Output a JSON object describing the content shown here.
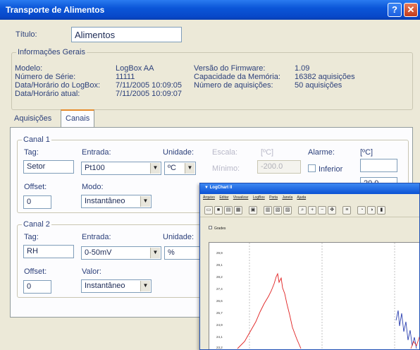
{
  "window": {
    "title": "Transporte de Alimentos",
    "help_glyph": "?",
    "close_glyph": "✕"
  },
  "titulo": {
    "label": "Título:",
    "value": "Alimentos"
  },
  "info": {
    "title": "Informações Gerais",
    "left_labels": [
      "Modelo:",
      "Número de Série:",
      "Data/Horário do LogBox:",
      "Data/Horário atual:"
    ],
    "left_values": [
      "LogBox AA",
      "11111",
      "7/11/2005 10:09:05",
      "7/11/2005 10:09:07"
    ],
    "right_labels": [
      "Versão do Firmware:",
      "Capacidade da Memória:",
      "Número de aquisições:"
    ],
    "right_values": [
      "1.09",
      "16382 aquisições",
      "50 aquisições"
    ]
  },
  "tabs": [
    {
      "label": "Aquisições"
    },
    {
      "label": "Canais"
    }
  ],
  "canal1": {
    "title": "Canal 1",
    "tag_label": "Tag:",
    "tag_value": "Setor",
    "entrada_label": "Entrada:",
    "entrada_value": "Pt100",
    "unidade_label": "Unidade:",
    "unidade_value": "ºC",
    "offset_label": "Offset:",
    "offset_value": "0",
    "modo_label": "Modo:",
    "modo_value": "Instantâneo",
    "escala_label": "Escala:",
    "escala_unit": "[ºC]",
    "minimo_label": "Mínimo:",
    "minimo_value": "-200.0",
    "alarme_label": "Alarme:",
    "alarme_unit": "[ºC]",
    "inferior_label": "Inferior",
    "superior_value": "20.0"
  },
  "canal2": {
    "title": "Canal 2",
    "tag_label": "Tag:",
    "tag_value": "RH",
    "entrada_label": "Entrada:",
    "entrada_value": "0-50mV",
    "unidade_label": "Unidade:",
    "unidade_value": "%",
    "offset_label": "Offset:",
    "offset_value": "0",
    "valor_label": "Valor:",
    "valor_value": "Instantâneo"
  },
  "logchart": {
    "title": "LogChart II",
    "menu": [
      "Arquivo",
      "Editar",
      "Visualizar",
      "LogBox",
      "Porta",
      "Janela",
      "Ajuda"
    ],
    "grades_label": "Grades",
    "yticks": [
      "29,9",
      "29,1",
      "28,2",
      "27,4",
      "26,6",
      "25,7",
      "24,9",
      "24,1",
      "23,2"
    ],
    "colors": {
      "series_red": "#e02020",
      "series_blue": "#2a3fb0"
    }
  }
}
